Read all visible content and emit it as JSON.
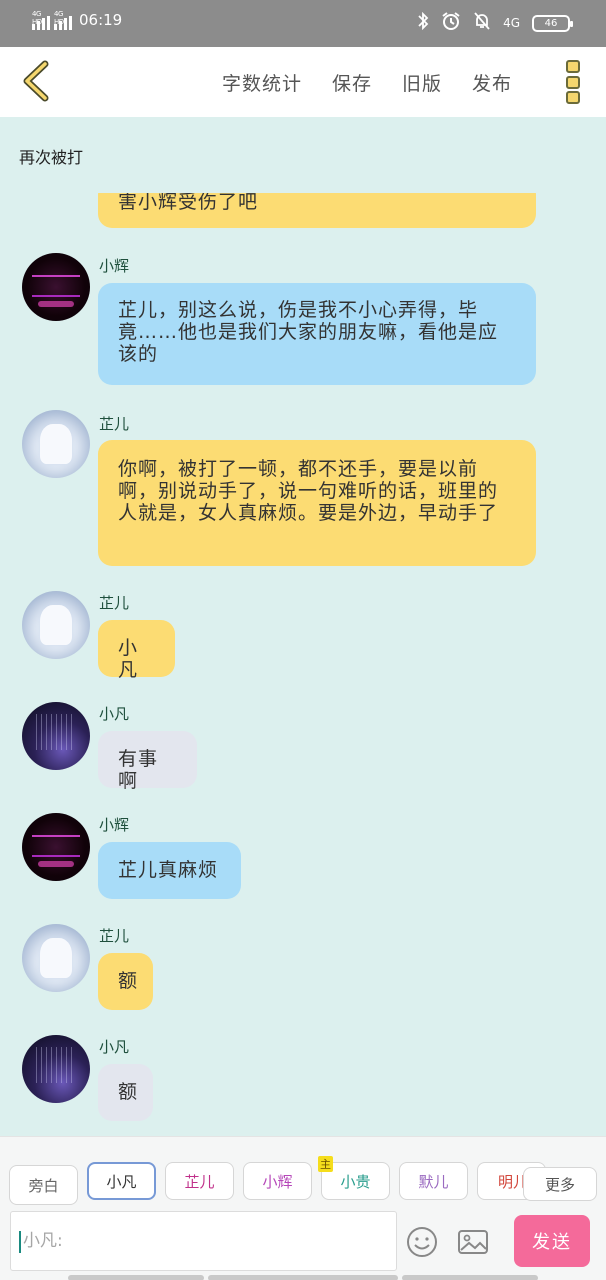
{
  "status_bar": {
    "network_1": "4G HD",
    "network_2": "4G HD",
    "time": "06:19",
    "network_right": "4G",
    "battery": "46"
  },
  "toolbar": {
    "word_count": "字数统计",
    "save": "保存",
    "old_version": "旧版",
    "publish": "发布"
  },
  "chat": {
    "title": "再次被打"
  },
  "messages": [
    {
      "speaker": "",
      "text": "害小辉受伤了吧",
      "color": "yellow"
    },
    {
      "speaker": "小辉",
      "text": "芷儿，别这么说，伤是我不小心弄得，毕竟……他也是我们大家的朋友嘛，看他是应该的",
      "color": "blue"
    },
    {
      "speaker": "芷儿",
      "text": "你啊，被打了一顿，都不还手，要是以前啊，别说动手了，说一句难听的话，班里的人就是，女人真麻烦。要是外边，早动手了",
      "color": "yellow"
    },
    {
      "speaker": "芷儿",
      "text": "小凡",
      "color": "yellow"
    },
    {
      "speaker": "小凡",
      "text": "有事啊",
      "color": "gray"
    },
    {
      "speaker": "小辉",
      "text": "芷儿真麻烦",
      "color": "blue"
    },
    {
      "speaker": "芷儿",
      "text": "额",
      "color": "yellow"
    },
    {
      "speaker": "小凡",
      "text": "额",
      "color": "gray"
    }
  ],
  "roles": [
    "旁白",
    "小凡",
    "芷儿",
    "小辉",
    "小贵",
    "默儿",
    "明儿"
  ],
  "role_tag": "主",
  "more": "更多",
  "composer": {
    "placeholder": "小凡:",
    "send": "发送"
  },
  "colors": {
    "accent_pink": "#f46a9a",
    "bubble_yellow": "#fcdc73",
    "bubble_blue": "#a8dcf8",
    "bubble_gray": "#e3e6ee",
    "background": "#dcf0ee"
  }
}
